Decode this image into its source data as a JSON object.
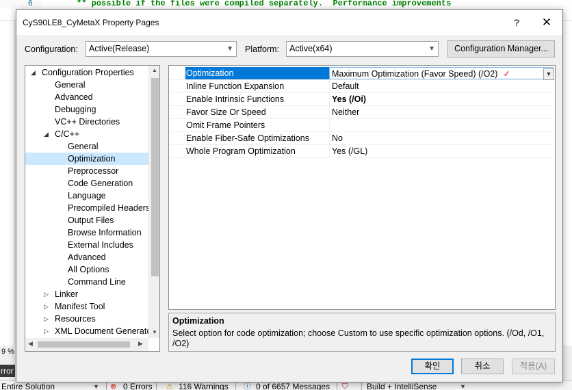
{
  "background": {
    "line_number": "6",
    "code_line1": "** possible if the files were compiled separately.  Performance improvements",
    "zoom": "9 %",
    "error_tab": "rror",
    "status": {
      "scope": "Entire Solution",
      "errors": "0 Errors",
      "warnings": "116 Warnings",
      "messages": "0 of 6657 Messages",
      "build": "Build + IntelliSense"
    }
  },
  "dialog": {
    "title": "CyS90LE8_CyMetaX Property Pages",
    "help": "?",
    "close": "✕",
    "configuration_label": "Configuration:",
    "configuration_value": "Active(Release)",
    "platform_label": "Platform:",
    "platform_value": "Active(x64)",
    "config_manager": "Configuration Manager..."
  },
  "tree": [
    {
      "label": "Configuration Properties",
      "level": 0,
      "toggle": "expanded"
    },
    {
      "label": "General",
      "level": 1
    },
    {
      "label": "Advanced",
      "level": 1
    },
    {
      "label": "Debugging",
      "level": 1
    },
    {
      "label": "VC++ Directories",
      "level": 1
    },
    {
      "label": "C/C++",
      "level": 1,
      "toggle": "expanded"
    },
    {
      "label": "General",
      "level": 2
    },
    {
      "label": "Optimization",
      "level": 2,
      "selected": true
    },
    {
      "label": "Preprocessor",
      "level": 2
    },
    {
      "label": "Code Generation",
      "level": 2
    },
    {
      "label": "Language",
      "level": 2
    },
    {
      "label": "Precompiled Headers",
      "level": 2
    },
    {
      "label": "Output Files",
      "level": 2
    },
    {
      "label": "Browse Information",
      "level": 2
    },
    {
      "label": "External Includes",
      "level": 2
    },
    {
      "label": "Advanced",
      "level": 2
    },
    {
      "label": "All Options",
      "level": 2
    },
    {
      "label": "Command Line",
      "level": 2
    },
    {
      "label": "Linker",
      "level": 1,
      "toggle": "collapsed"
    },
    {
      "label": "Manifest Tool",
      "level": 1,
      "toggle": "collapsed"
    },
    {
      "label": "Resources",
      "level": 1,
      "toggle": "collapsed"
    },
    {
      "label": "XML Document Generato",
      "level": 1,
      "toggle": "collapsed"
    }
  ],
  "properties": [
    {
      "name": "Optimization",
      "value": "Maximum Optimization (Favor Speed) (/O2)",
      "selected": true
    },
    {
      "name": "Inline Function Expansion",
      "value": "Default"
    },
    {
      "name": "Enable Intrinsic Functions",
      "value": "Yes (/Oi)",
      "bold": true
    },
    {
      "name": "Favor Size Or Speed",
      "value": "Neither"
    },
    {
      "name": "Omit Frame Pointers",
      "value": ""
    },
    {
      "name": "Enable Fiber-Safe Optimizations",
      "value": "No"
    },
    {
      "name": "Whole Program Optimization",
      "value": "Yes (/GL)"
    }
  ],
  "description": {
    "title": "Optimization",
    "text": "Select option for code optimization; choose Custom to use specific optimization options.     (/Od, /O1, /O2)"
  },
  "buttons": {
    "ok": "확인",
    "cancel": "취소",
    "apply": "적용(A)"
  },
  "colors": {
    "selection": "#0078d7",
    "tree_selection": "#cce8ff",
    "checkmark": "#e81123"
  }
}
